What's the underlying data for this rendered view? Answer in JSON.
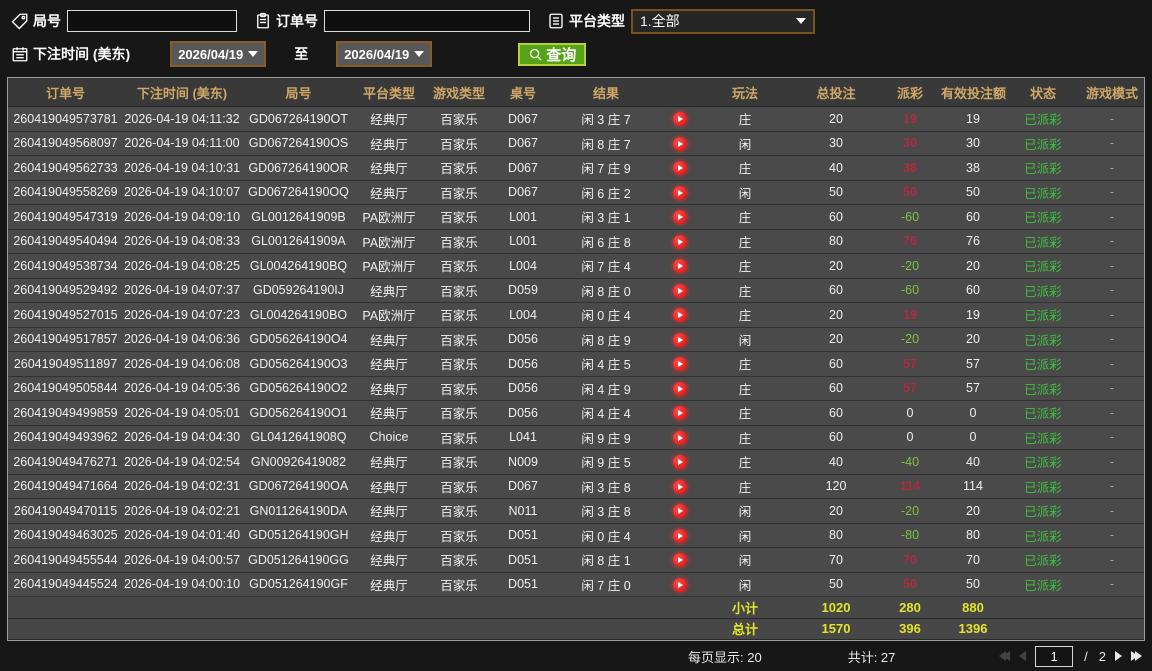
{
  "filters": {
    "round_label": "局号",
    "order_label": "订单号",
    "platform_label": "平台类型",
    "platform_value": "1.全部",
    "bet_time_label": "下注时间 (美东)",
    "date_from": "2026/04/19",
    "to_label": "至",
    "date_to": "2026/04/19",
    "query_label": "查询"
  },
  "icons": {
    "round": "tag-icon",
    "order": "clipboard-icon",
    "platform": "list-icon",
    "bet_time": "calendar-icon",
    "query": "search-icon",
    "row_action": "play-icon",
    "pagination": [
      "first-page-icon",
      "prev-page-icon",
      "next-page-icon",
      "last-page-icon"
    ]
  },
  "colors": {
    "header_gold": "#cfa767",
    "payout_win_red": "#b02a43",
    "payout_loss_green": "#7cc244",
    "status_green": "#3ec23e",
    "summary_yellow": "#e4e42a",
    "query_button_green": "#55a318",
    "select_border_brown": "#8a5a28",
    "row_bg": "#4a4a4a"
  },
  "table": {
    "columns": [
      "订单号",
      "下注时间 (美东)",
      "局号",
      "平台类型",
      "游戏类型",
      "桌号",
      "结果",
      "",
      "玩法",
      "总投注",
      "派彩",
      "有效投注额",
      "状态",
      "游戏模式"
    ],
    "rows": [
      {
        "order": "260419049573781",
        "time": "2026-04-19 04:11:32",
        "round": "GD067264190OT",
        "platform": "经典厅",
        "game": "百家乐",
        "table": "D067",
        "result": "闲 3 庄 7",
        "play": "庄",
        "bet": "20",
        "payout": "19",
        "valid": "19",
        "status": "已派彩",
        "mode": "-"
      },
      {
        "order": "260419049568097",
        "time": "2026-04-19 04:11:00",
        "round": "GD067264190OS",
        "platform": "经典厅",
        "game": "百家乐",
        "table": "D067",
        "result": "闲 8 庄 7",
        "play": "闲",
        "bet": "30",
        "payout": "30",
        "valid": "30",
        "status": "已派彩",
        "mode": "-"
      },
      {
        "order": "260419049562733",
        "time": "2026-04-19 04:10:31",
        "round": "GD067264190OR",
        "platform": "经典厅",
        "game": "百家乐",
        "table": "D067",
        "result": "闲 7 庄 9",
        "play": "庄",
        "bet": "40",
        "payout": "38",
        "valid": "38",
        "status": "已派彩",
        "mode": "-"
      },
      {
        "order": "260419049558269",
        "time": "2026-04-19 04:10:07",
        "round": "GD067264190OQ",
        "platform": "经典厅",
        "game": "百家乐",
        "table": "D067",
        "result": "闲 6 庄 2",
        "play": "闲",
        "bet": "50",
        "payout": "50",
        "valid": "50",
        "status": "已派彩",
        "mode": "-"
      },
      {
        "order": "260419049547319",
        "time": "2026-04-19 04:09:10",
        "round": "GL0012641909B",
        "platform": "PA欧洲厅",
        "game": "百家乐",
        "table": "L001",
        "result": "闲 3 庄 1",
        "play": "庄",
        "bet": "60",
        "payout": "-60",
        "valid": "60",
        "status": "已派彩",
        "mode": "-"
      },
      {
        "order": "260419049540494",
        "time": "2026-04-19 04:08:33",
        "round": "GL0012641909A",
        "platform": "PA欧洲厅",
        "game": "百家乐",
        "table": "L001",
        "result": "闲 6 庄 8",
        "play": "庄",
        "bet": "80",
        "payout": "76",
        "valid": "76",
        "status": "已派彩",
        "mode": "-"
      },
      {
        "order": "260419049538734",
        "time": "2026-04-19 04:08:25",
        "round": "GL004264190BQ",
        "platform": "PA欧洲厅",
        "game": "百家乐",
        "table": "L004",
        "result": "闲 7 庄 4",
        "play": "庄",
        "bet": "20",
        "payout": "-20",
        "valid": "20",
        "status": "已派彩",
        "mode": "-"
      },
      {
        "order": "260419049529492",
        "time": "2026-04-19 04:07:37",
        "round": "GD059264190IJ",
        "platform": "经典厅",
        "game": "百家乐",
        "table": "D059",
        "result": "闲 8 庄 0",
        "play": "庄",
        "bet": "60",
        "payout": "-60",
        "valid": "60",
        "status": "已派彩",
        "mode": "-"
      },
      {
        "order": "260419049527015",
        "time": "2026-04-19 04:07:23",
        "round": "GL004264190BO",
        "platform": "PA欧洲厅",
        "game": "百家乐",
        "table": "L004",
        "result": "闲 0 庄 4",
        "play": "庄",
        "bet": "20",
        "payout": "19",
        "valid": "19",
        "status": "已派彩",
        "mode": "-"
      },
      {
        "order": "260419049517857",
        "time": "2026-04-19 04:06:36",
        "round": "GD056264190O4",
        "platform": "经典厅",
        "game": "百家乐",
        "table": "D056",
        "result": "闲 8 庄 9",
        "play": "闲",
        "bet": "20",
        "payout": "-20",
        "valid": "20",
        "status": "已派彩",
        "mode": "-"
      },
      {
        "order": "260419049511897",
        "time": "2026-04-19 04:06:08",
        "round": "GD056264190O3",
        "platform": "经典厅",
        "game": "百家乐",
        "table": "D056",
        "result": "闲 4 庄 5",
        "play": "庄",
        "bet": "60",
        "payout": "57",
        "valid": "57",
        "status": "已派彩",
        "mode": "-"
      },
      {
        "order": "260419049505844",
        "time": "2026-04-19 04:05:36",
        "round": "GD056264190O2",
        "platform": "经典厅",
        "game": "百家乐",
        "table": "D056",
        "result": "闲 4 庄 9",
        "play": "庄",
        "bet": "60",
        "payout": "57",
        "valid": "57",
        "status": "已派彩",
        "mode": "-"
      },
      {
        "order": "260419049499859",
        "time": "2026-04-19 04:05:01",
        "round": "GD056264190O1",
        "platform": "经典厅",
        "game": "百家乐",
        "table": "D056",
        "result": "闲 4 庄 4",
        "play": "庄",
        "bet": "60",
        "payout": "0",
        "valid": "0",
        "status": "已派彩",
        "mode": "-"
      },
      {
        "order": "260419049493962",
        "time": "2026-04-19 04:04:30",
        "round": "GL0412641908Q",
        "platform": "Choice",
        "game": "百家乐",
        "table": "L041",
        "result": "闲 9 庄 9",
        "play": "庄",
        "bet": "60",
        "payout": "0",
        "valid": "0",
        "status": "已派彩",
        "mode": "-"
      },
      {
        "order": "260419049476271",
        "time": "2026-04-19 04:02:54",
        "round": "GN00926419082",
        "platform": "经典厅",
        "game": "百家乐",
        "table": "N009",
        "result": "闲 9 庄 5",
        "play": "庄",
        "bet": "40",
        "payout": "-40",
        "valid": "40",
        "status": "已派彩",
        "mode": "-"
      },
      {
        "order": "260419049471664",
        "time": "2026-04-19 04:02:31",
        "round": "GD067264190OA",
        "platform": "经典厅",
        "game": "百家乐",
        "table": "D067",
        "result": "闲 3 庄 8",
        "play": "庄",
        "bet": "120",
        "payout": "114",
        "valid": "114",
        "status": "已派彩",
        "mode": "-"
      },
      {
        "order": "260419049470115",
        "time": "2026-04-19 04:02:21",
        "round": "GN011264190DA",
        "platform": "经典厅",
        "game": "百家乐",
        "table": "N011",
        "result": "闲 3 庄 8",
        "play": "闲",
        "bet": "20",
        "payout": "-20",
        "valid": "20",
        "status": "已派彩",
        "mode": "-"
      },
      {
        "order": "260419049463025",
        "time": "2026-04-19 04:01:40",
        "round": "GD051264190GH",
        "platform": "经典厅",
        "game": "百家乐",
        "table": "D051",
        "result": "闲 0 庄 4",
        "play": "闲",
        "bet": "80",
        "payout": "-80",
        "valid": "80",
        "status": "已派彩",
        "mode": "-"
      },
      {
        "order": "260419049455544",
        "time": "2026-04-19 04:00:57",
        "round": "GD051264190GG",
        "platform": "经典厅",
        "game": "百家乐",
        "table": "D051",
        "result": "闲 8 庄 1",
        "play": "闲",
        "bet": "70",
        "payout": "70",
        "valid": "70",
        "status": "已派彩",
        "mode": "-"
      },
      {
        "order": "260419049445524",
        "time": "2026-04-19 04:00:10",
        "round": "GD051264190GF",
        "platform": "经典厅",
        "game": "百家乐",
        "table": "D051",
        "result": "闲 7 庄 0",
        "play": "闲",
        "bet": "50",
        "payout": "50",
        "valid": "50",
        "status": "已派彩",
        "mode": "-"
      }
    ],
    "subtotal": {
      "label": "小计",
      "bet": "1020",
      "payout": "280",
      "valid": "880"
    },
    "total": {
      "label": "总计",
      "bet": "1570",
      "payout": "396",
      "valid": "1396"
    }
  },
  "footer": {
    "page_size_label": "每页显示: 20",
    "total_count_label": "共计: 27",
    "page_current": "1",
    "page_separator": "/",
    "page_total": "2"
  }
}
